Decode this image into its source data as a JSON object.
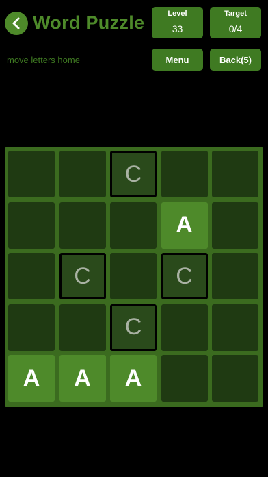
{
  "header": {
    "title": "Word Puzzle",
    "subtitle": "move letters home",
    "level": {
      "label": "Level",
      "value": "33"
    },
    "target": {
      "label": "Target",
      "value": "0/4"
    },
    "menu_label": "Menu",
    "back_label": "Back(5)",
    "back_icon": "chevron-left-icon"
  },
  "colors": {
    "accent": "#4e8a2a",
    "button": "#3f7a22",
    "board": "#3b6b1f",
    "empty_cell": "#1f3a12"
  },
  "board": {
    "rows": [
      [
        "",
        "",
        "C",
        "",
        ""
      ],
      [
        "",
        "",
        "",
        "A",
        ""
      ],
      [
        "",
        "C",
        "",
        "C",
        ""
      ],
      [
        "",
        "",
        "C",
        "",
        ""
      ],
      [
        "A",
        "A",
        "A",
        "",
        ""
      ]
    ]
  }
}
